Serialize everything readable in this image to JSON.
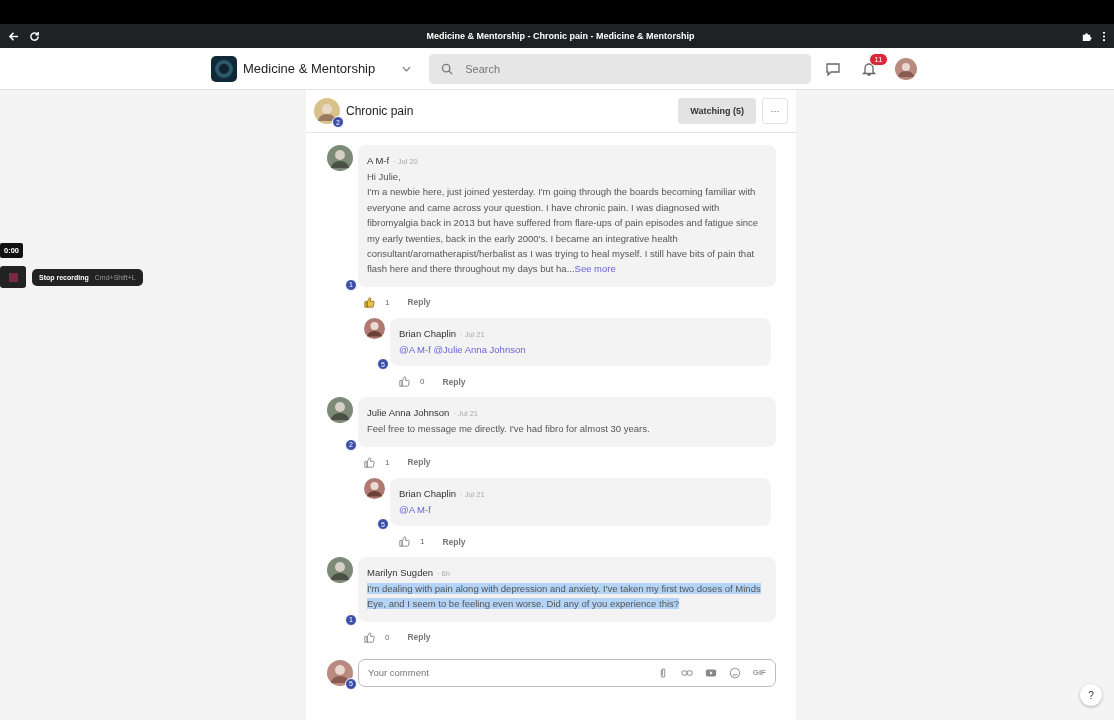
{
  "browser": {
    "title": "Medicine & Mentorship - Chronic pain - Medicine & Mentorship"
  },
  "header": {
    "community": "Medicine & Mentorship",
    "search_placeholder": "Search",
    "notification_count": "11"
  },
  "topic": {
    "title": "Chronic pain",
    "badge": "2",
    "watching": "Watching (5)",
    "more": "···"
  },
  "comments": [
    {
      "author": "A M-f",
      "badge": "1",
      "date": "· Jul 20",
      "highlighted": false,
      "lines": [
        "Hi Julie,",
        "I'm a newbie here, just joined yesterday. I'm going through the boards becoming familiar with everyone and came across your question. I have chronic pain. I was diagnosed with fibromyalgia back in 2013 but have suffered from flare-ups of pain episodes and fatigue since my early twenties, back in the early 2000's. I became an integrative health consultant/aromatherapist/herbalist as I was trying to heal myself. I still have bits of pain that flash here and there throughout my days but ha..."
      ],
      "see_more": "See more",
      "likes": "1",
      "liked": true,
      "reply": "Reply",
      "replies": [
        {
          "author": "Brian Chaplin",
          "badge": "5",
          "date": "· Jul 21",
          "mention": true,
          "lines": [
            "@A M-f @Julie Anna Johnson"
          ],
          "likes": "0",
          "liked": false,
          "reply": "Reply"
        }
      ]
    },
    {
      "author": "Julie Anna Johnson",
      "badge": "2",
      "date": "· Jul 21",
      "highlighted": false,
      "lines": [
        "Feel free to message me directly. I've had fibro for almost 30 years."
      ],
      "likes": "1",
      "liked": false,
      "reply": "Reply",
      "replies": [
        {
          "author": "Brian Chaplin",
          "badge": "5",
          "date": "· Jul 21",
          "mention": true,
          "lines": [
            "@A M-f"
          ],
          "likes": "1",
          "liked": false,
          "reply": "Reply"
        }
      ]
    },
    {
      "author": "Marilyn Sugden",
      "badge": "1",
      "date": "· 6h",
      "highlighted": true,
      "lines": [
        "I'm dealing with pain along with depression and anxiety. I've taken my first two doses of Minds Eye, and I seem to be feeling even worse. Did any of you experience this?"
      ],
      "likes": "0",
      "liked": false,
      "reply": "Reply"
    }
  ],
  "composer": {
    "badge": "5",
    "placeholder": "Your comment",
    "gif": "GIF"
  },
  "recorder": {
    "time": "0:00",
    "tooltip": "Stop recording",
    "shortcut": "Cmd+Shift+L"
  },
  "help": "?"
}
